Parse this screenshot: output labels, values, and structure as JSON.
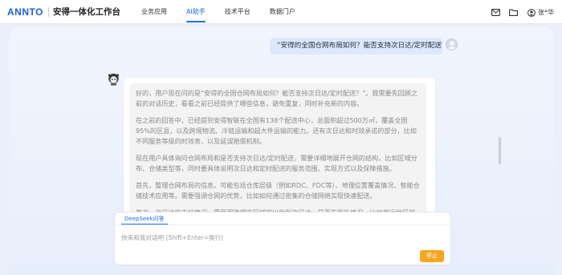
{
  "header": {
    "logo": "ANNTO",
    "app_title": "安得一体化工作台",
    "nav": [
      "业务应用",
      "AI助手",
      "技术平台",
      "数据门户"
    ],
    "active_nav": "AI助手",
    "user_name": "张*华",
    "icons": [
      "mail-icon",
      "folder-icon",
      "user-icon"
    ]
  },
  "chat": {
    "user_message": "“安得的全国仓网布局如何？能否支持次日达/定时配送？”",
    "assistant_paragraphs": [
      "好的，用户现在问的是“安得的全国仓网布局如何？能否支持次日达/定时配送？”。我需要先回顾之前的对话历史，看看之前已经提供了哪些信息，避免重复，同时补充新的内容。",
      "在之前的回答中，已经提到安得智联在全国有138个配送中心，总面积超过500万㎡，覆盖全国95%的区县，以及跨境物流、冷链运输和超大件运输的能力。还有次日达和时效承诺的部分，比如不同服务等级的时效表，以及延误赔偿机制。",
      "现在用户具体询问仓网布局和是否支持次日达/定时配送，需要详细地展开仓网的结构，比如区域分布、仓储类型等，同时要具体说明次日达和定时配送的服务范围、实现方式以及保障措施。",
      "首先，整理仓网布局的信息。可能包括仓库层级（例如RDC、FDC等）、地理位置覆盖情况、智能仓储技术应用等。需要强调仓网的优势，比如如何通过密集的仓储网络实现快速配送。",
      "其次，次日达的支持情况。需要明确哪些区域可以做到次日达，是否有例外情况，比如偏远地区可能不支持，可以引用具体的数据，比如核心城市覆盖率、订单占比等，增强说服力。"
    ]
  },
  "input": {
    "tab_label": "DeepSeek问答",
    "placeholder": "快来和我对话吧 (Shift+Enter=换行)",
    "value": "",
    "stop_button": "停止"
  },
  "colors": {
    "accent": "#1a6fe8",
    "stop_button": "#f5a623",
    "user_bubble": "#dde9fb",
    "thinking_bg": "#f3f3f3"
  }
}
